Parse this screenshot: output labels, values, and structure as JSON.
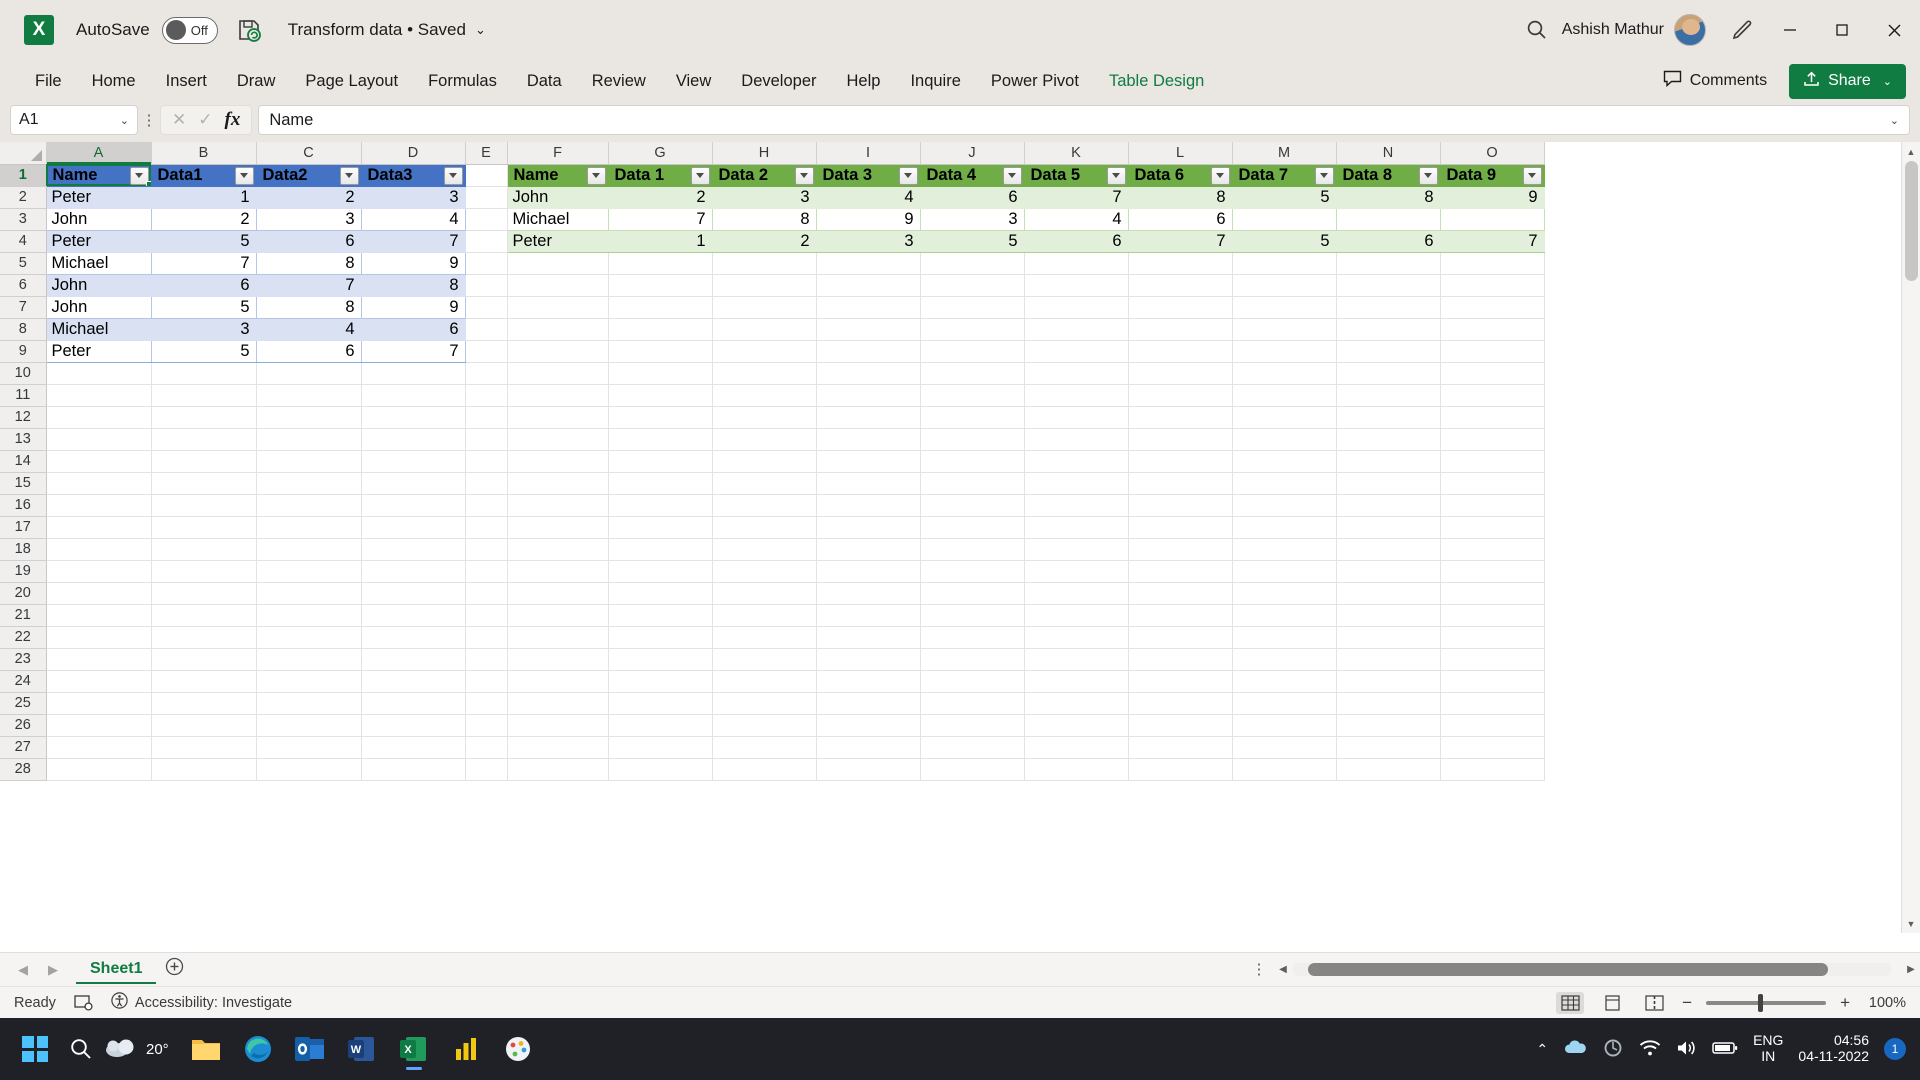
{
  "titlebar": {
    "app_icon": "excel-logo",
    "autosave_label": "AutoSave",
    "autosave_state": "Off",
    "save_icon": "save-refresh-icon",
    "document_title": "Transform data • Saved",
    "title_chevron": "⌄",
    "search_icon": "search-icon",
    "user_name": "Ashish Mathur",
    "pen_icon": "pen-icon",
    "minimize": "—",
    "maximize": "▢",
    "close": "✕"
  },
  "ribbon": {
    "tabs": [
      {
        "label": "File",
        "contextual": false
      },
      {
        "label": "Home",
        "contextual": false
      },
      {
        "label": "Insert",
        "contextual": false
      },
      {
        "label": "Draw",
        "contextual": false
      },
      {
        "label": "Page Layout",
        "contextual": false
      },
      {
        "label": "Formulas",
        "contextual": false
      },
      {
        "label": "Data",
        "contextual": false
      },
      {
        "label": "Review",
        "contextual": false
      },
      {
        "label": "View",
        "contextual": false
      },
      {
        "label": "Developer",
        "contextual": false
      },
      {
        "label": "Help",
        "contextual": false
      },
      {
        "label": "Inquire",
        "contextual": false
      },
      {
        "label": "Power Pivot",
        "contextual": false
      },
      {
        "label": "Table Design",
        "contextual": true
      }
    ],
    "comments_label": "Comments",
    "share_label": "Share",
    "share_chevron": "⌄",
    "accent_green": "#107c41"
  },
  "formula_bar": {
    "name_box_value": "A1",
    "name_box_chevron": "⌄",
    "cancel_icon": "cancel-icon",
    "confirm_icon": "confirm-icon",
    "function_icon": "fx",
    "formula_value": "Name",
    "expand_chevron": "⌄"
  },
  "grid": {
    "column_headers": [
      "A",
      "B",
      "C",
      "D",
      "E",
      "F",
      "G",
      "H",
      "I",
      "J",
      "K",
      "L",
      "M",
      "N",
      "O"
    ],
    "row_headers": [
      1,
      2,
      3,
      4,
      5,
      6,
      7,
      8,
      9,
      10,
      11,
      12,
      13,
      14,
      15,
      16,
      17,
      18,
      19,
      20,
      21,
      22,
      23,
      24,
      25,
      26,
      27,
      28
    ],
    "selected_cell": "A1",
    "selected_column": "A",
    "selected_row": 1
  },
  "table_blue": {
    "accent": "#4472c4",
    "band_color": "#d9e1f2",
    "range": "A1:D9",
    "headers": [
      "Name",
      "Data1",
      "Data2",
      "Data3"
    ],
    "rows": [
      [
        "Peter",
        "1",
        "2",
        "3"
      ],
      [
        "John",
        "2",
        "3",
        "4"
      ],
      [
        "Peter",
        "5",
        "6",
        "7"
      ],
      [
        "Michael",
        "7",
        "8",
        "9"
      ],
      [
        "John",
        "6",
        "7",
        "8"
      ],
      [
        "John",
        "5",
        "8",
        "9"
      ],
      [
        "Michael",
        "3",
        "4",
        "6"
      ],
      [
        "Peter",
        "5",
        "6",
        "7"
      ]
    ]
  },
  "table_green": {
    "accent": "#70ad47",
    "band_color": "#e2efda",
    "range": "F1:O4",
    "headers": [
      "Name",
      "Data 1",
      "Data 2",
      "Data 3",
      "Data 4",
      "Data 5",
      "Data 6",
      "Data 7",
      "Data 8",
      "Data 9"
    ],
    "rows": [
      [
        "John",
        "2",
        "3",
        "4",
        "6",
        "7",
        "8",
        "5",
        "8",
        "9"
      ],
      [
        "Michael",
        "7",
        "8",
        "9",
        "3",
        "4",
        "6",
        "",
        "",
        ""
      ],
      [
        "Peter",
        "1",
        "2",
        "3",
        "5",
        "6",
        "7",
        "5",
        "6",
        "7"
      ]
    ]
  },
  "sheet_bar": {
    "prev_icon": "◀",
    "next_icon": "▶",
    "sheets": [
      {
        "label": "Sheet1",
        "active": true
      }
    ],
    "add_sheet_icon": "+",
    "options_icon": "⋮",
    "hscroll_left": "◀",
    "hscroll_right": "▶"
  },
  "status_bar": {
    "state": "Ready",
    "macro_icon": "record-macro-icon",
    "accessibility_icon": "accessibility-icon",
    "accessibility_text": "Accessibility: Investigate",
    "view_normal_icon": "normal-view-icon",
    "view_pagelayout_icon": "page-layout-view-icon",
    "view_pagebreak_icon": "page-break-view-icon",
    "zoom_out": "−",
    "zoom_in": "+",
    "zoom_level": "100%"
  },
  "taskbar": {
    "start_icon": "windows-start-icon",
    "search_icon": "search-icon",
    "weather_temp": "20°",
    "weather_icon": "cloudy-icon",
    "apps": [
      {
        "name": "file-explorer-icon"
      },
      {
        "name": "edge-browser-icon"
      },
      {
        "name": "outlook-icon"
      },
      {
        "name": "word-icon"
      },
      {
        "name": "excel-icon",
        "running": true
      },
      {
        "name": "power-bi-icon"
      },
      {
        "name": "paint-icon"
      }
    ],
    "tray_chevron": "⌃",
    "onedrive_icon": "onedrive-icon",
    "update_icon": "windows-update-icon",
    "network_icon": "wifi-icon",
    "volume_icon": "speaker-icon",
    "battery_icon": "battery-icon",
    "language_line1": "ENG",
    "language_line2": "IN",
    "clock_time": "04:56",
    "clock_date": "04-11-2022",
    "notification_count": "1"
  }
}
